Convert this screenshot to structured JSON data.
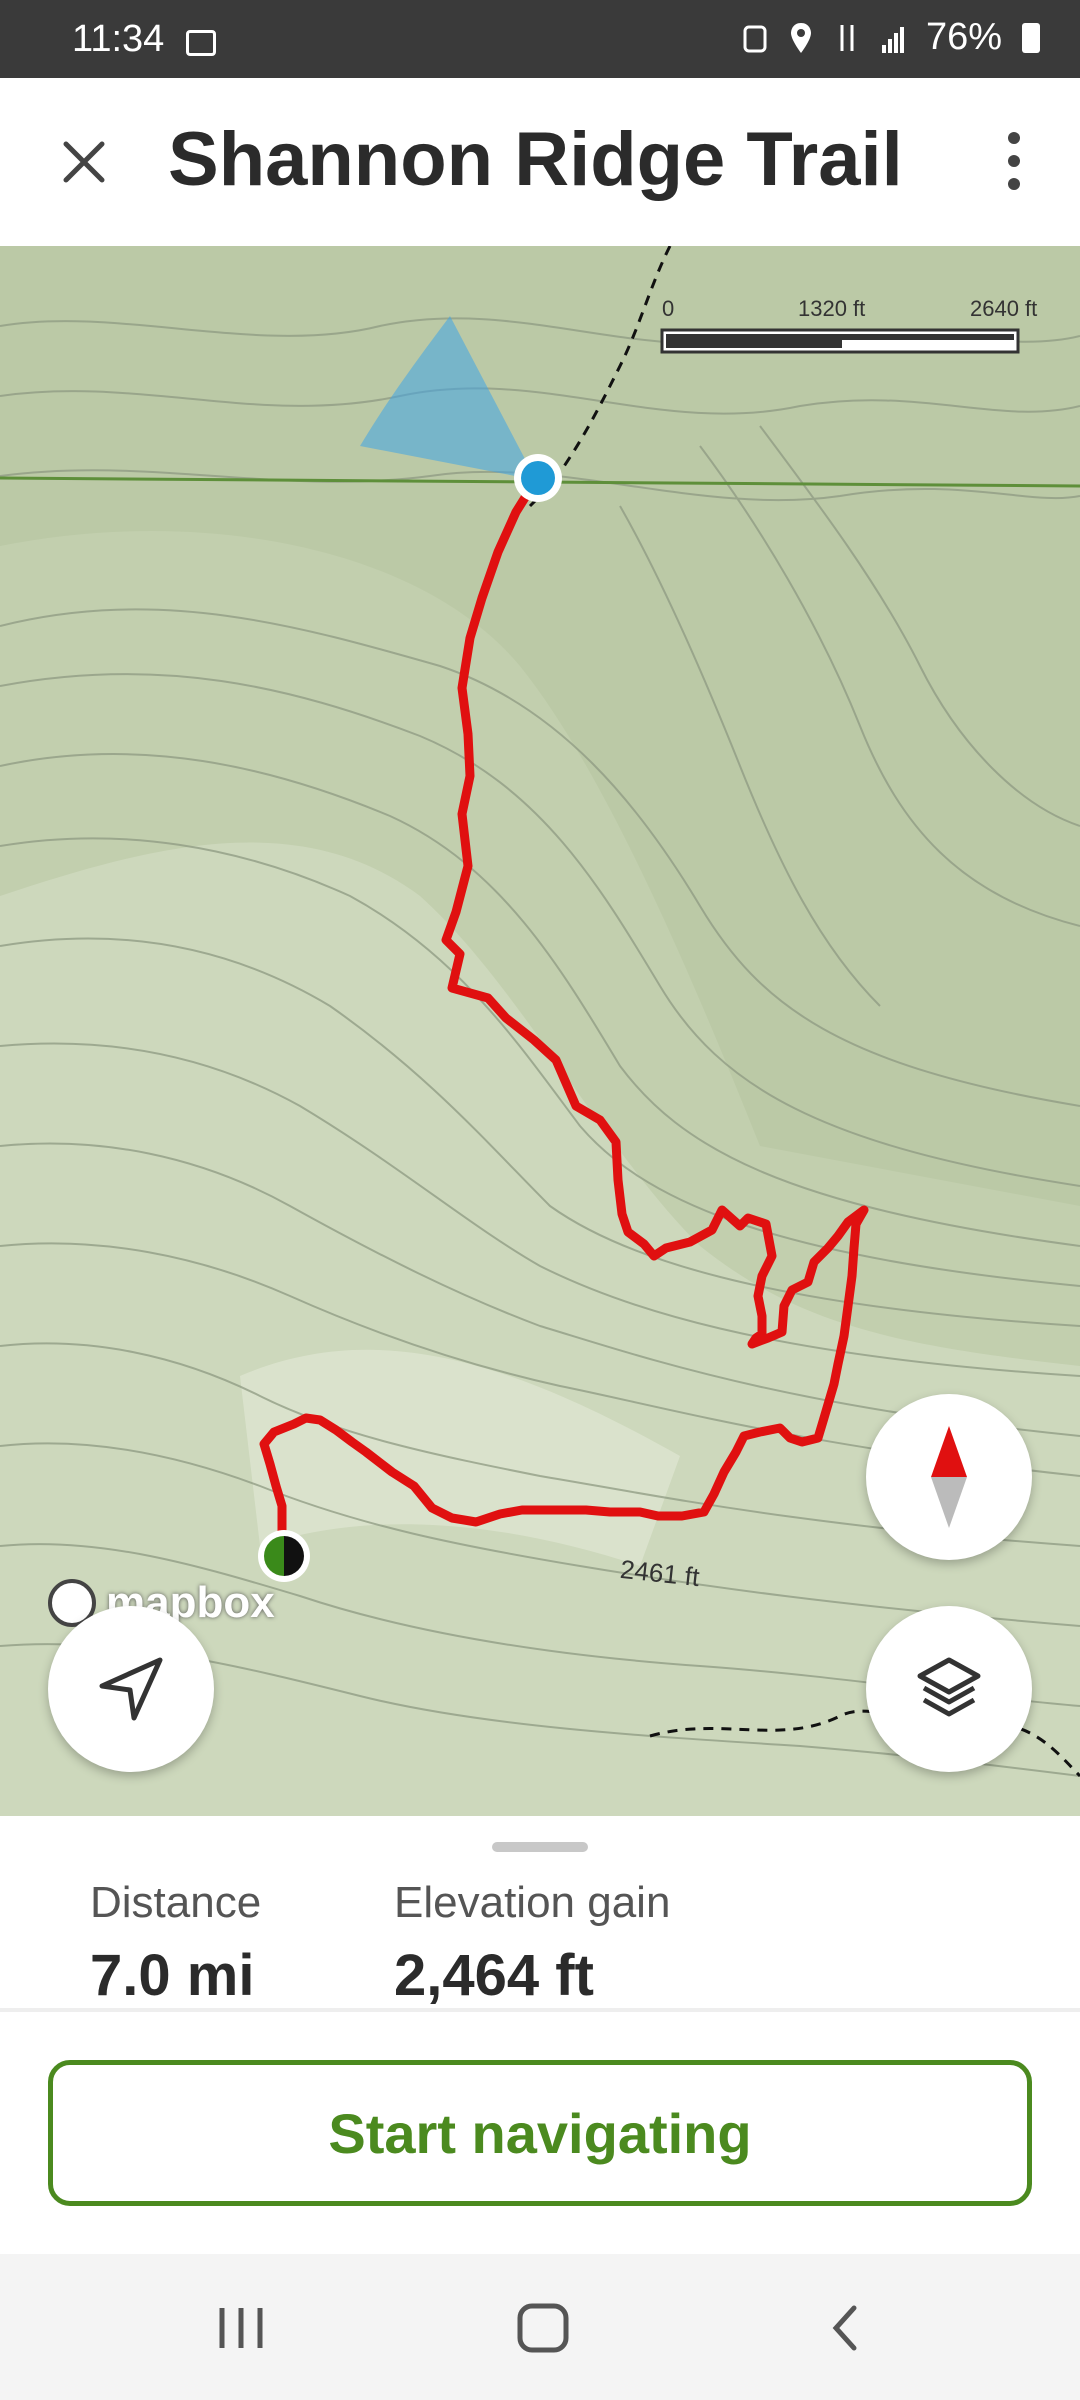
{
  "status_bar": {
    "time": "11:34",
    "battery": "76%"
  },
  "header": {
    "title": "Shannon Ridge Trail"
  },
  "map": {
    "scale_labels": [
      "0",
      "1320 ft",
      "2640 ft"
    ],
    "attribution": "mapbox",
    "elevation_label": "2461 ft",
    "route_color": "#e01010",
    "location_color": "#1f9ad6"
  },
  "stats": {
    "distance_label": "Distance",
    "distance_value": "7.0 mi",
    "elevation_label": "Elevation gain",
    "elevation_value": "2,464 ft"
  },
  "actions": {
    "start_label": "Start navigating"
  }
}
